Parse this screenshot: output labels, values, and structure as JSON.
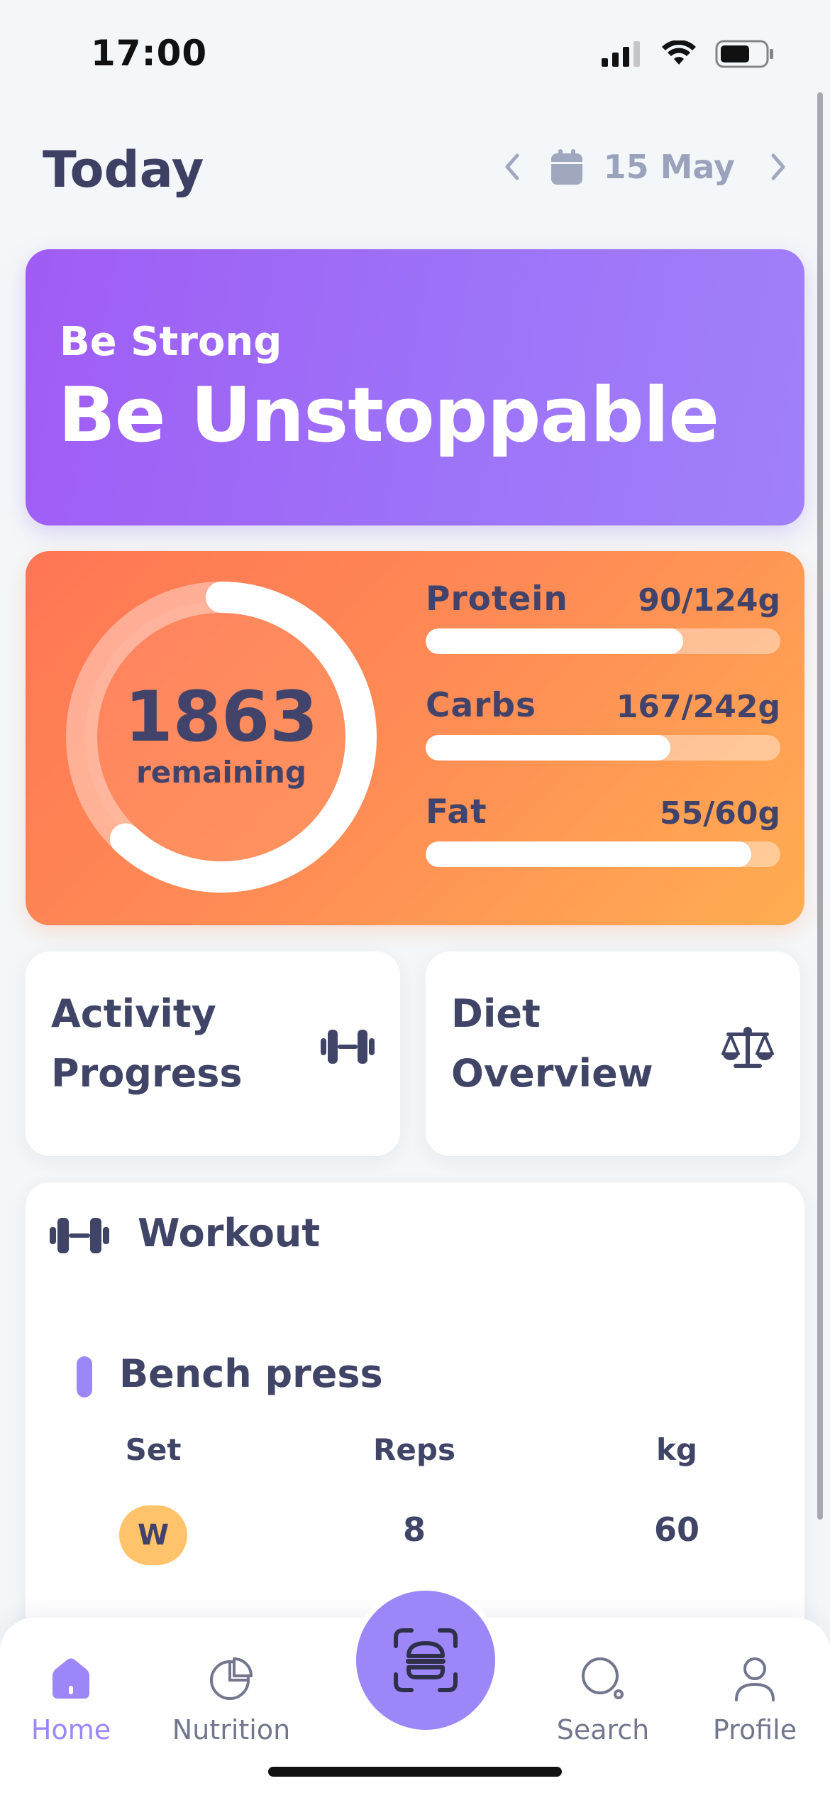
{
  "status_bar": {
    "time": "17:00"
  },
  "header": {
    "title": "Today",
    "date": "15 May"
  },
  "motivation": {
    "subtitle": "Be Strong",
    "headline": "Be Unstoppable"
  },
  "calories": {
    "remaining_value": "1863",
    "remaining_label": "remaining",
    "ring_progress": 0.62,
    "macros": [
      {
        "name": "Protein",
        "value": "90/124g",
        "fraction": 0.726
      },
      {
        "name": "Carbs",
        "value": "167/242g",
        "fraction": 0.69
      },
      {
        "name": "Fat",
        "value": "55/60g",
        "fraction": 0.917
      }
    ]
  },
  "cards": {
    "activity": {
      "line1": "Activity",
      "line2": "Progress",
      "icon": "dumbbell-icon"
    },
    "diet": {
      "line1": "Diet",
      "line2": "Overview",
      "icon": "scale-icon"
    }
  },
  "workout": {
    "title": "Workout",
    "exercise": "Bench press",
    "columns": [
      "Set",
      "Reps",
      "kg"
    ],
    "rows": [
      {
        "set": "W",
        "reps": "8",
        "kg": "60"
      }
    ]
  },
  "tabbar": {
    "items": [
      {
        "label": "Home",
        "icon": "home-icon",
        "active": true
      },
      {
        "label": "Nutrition",
        "icon": "pie-chart-icon",
        "active": false
      },
      {
        "label": "Search",
        "icon": "search-icon",
        "active": false
      },
      {
        "label": "Profile",
        "icon": "user-icon",
        "active": false
      }
    ],
    "center_icon": "scan-food-icon"
  },
  "colors": {
    "accent": "#9d86f7",
    "motivation_gradient": [
      "#a05cf5",
      "#a080fb"
    ],
    "calories_gradient": [
      "#ff7655",
      "#ffae52"
    ],
    "text": "#404466",
    "badge_warmup": "#ffc46b"
  }
}
